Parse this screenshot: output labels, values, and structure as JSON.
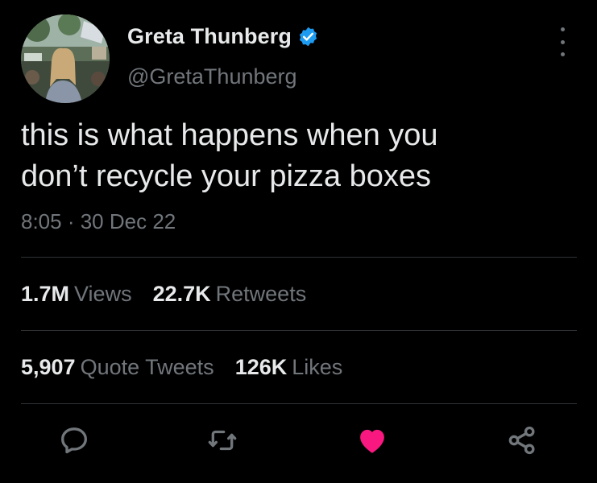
{
  "author": {
    "name": "Greta Thunberg",
    "handle": "@GretaThunberg",
    "verified": true,
    "avatar_icon": "profile-photo"
  },
  "tweet": {
    "text_line1": "this is what happens when you",
    "text_line2": "don’t recycle your pizza boxes",
    "timestamp": "8:05 · 30 Dec 22"
  },
  "stats": {
    "views_num": "1.7M",
    "views_label": "Views",
    "retweets_num": "22.7K",
    "retweets_label": "Retweets",
    "quotes_num": "5,907",
    "quotes_label": "Quote Tweets",
    "likes_num": "126K",
    "likes_label": "Likes"
  },
  "colors": {
    "background": "#000000",
    "text": "#e7e9ea",
    "muted": "#71767b",
    "verified": "#1d9bf0",
    "liked": "#f91880",
    "divider": "#2f3336"
  },
  "actions": [
    "reply-icon",
    "retweet-icon",
    "like-icon",
    "share-icon"
  ]
}
